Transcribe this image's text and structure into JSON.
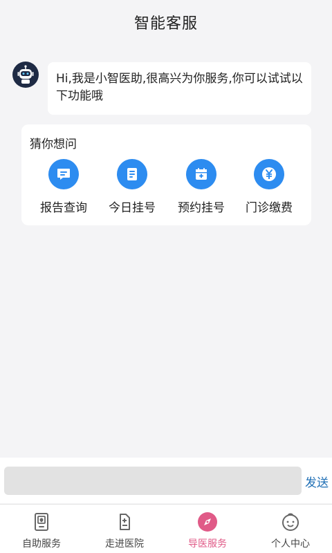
{
  "header": {
    "title": "智能客服"
  },
  "chat": {
    "bot_message": "Hi,我是小智医助,很高兴为你服务,你可以试试以下功能哦"
  },
  "suggest": {
    "title": "猜你想问",
    "items": [
      {
        "label": "报告查询",
        "icon": "message-icon"
      },
      {
        "label": "今日挂号",
        "icon": "document-icon"
      },
      {
        "label": "预约挂号",
        "icon": "calendar-plus-icon"
      },
      {
        "label": "门诊缴费",
        "icon": "yen-icon"
      }
    ]
  },
  "input": {
    "value": "",
    "placeholder": "",
    "send_label": "发送"
  },
  "tabbar": {
    "active_index": 2,
    "items": [
      {
        "label": "自助服务",
        "icon": "kiosk-icon"
      },
      {
        "label": "走进医院",
        "icon": "hospital-icon"
      },
      {
        "label": "导医服务",
        "icon": "compass-icon"
      },
      {
        "label": "个人中心",
        "icon": "baby-face-icon"
      }
    ]
  },
  "colors": {
    "accent": "#2d8cf0",
    "tab_active": "#e05a87",
    "send": "#1f6fb5",
    "background": "#f4f4f6"
  }
}
